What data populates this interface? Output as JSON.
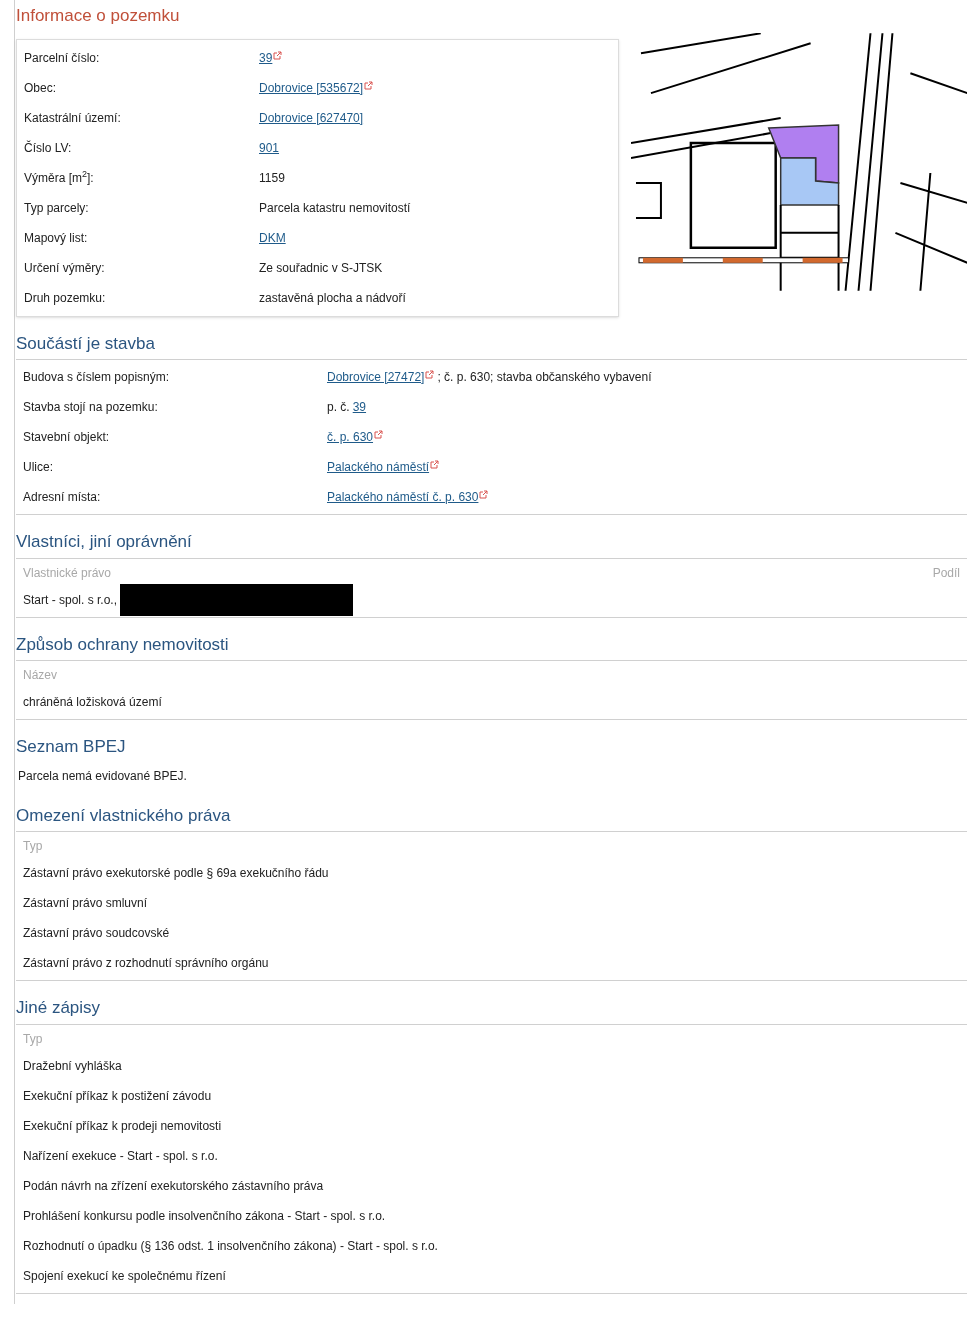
{
  "sections": [
    {
      "kind": "info",
      "title": "Informace o pozemku",
      "rows": [
        {
          "label": "Parcelní číslo:",
          "value": [
            {
              "kind": "link",
              "text": "39",
              "external": true
            }
          ]
        },
        {
          "label": "Obec:",
          "value": [
            {
              "kind": "link",
              "text": "Dobrovice [535672]",
              "external": true
            }
          ]
        },
        {
          "label": "Katastrální území:",
          "value": [
            {
              "kind": "link",
              "text": "Dobrovice [627470]",
              "external": false
            }
          ]
        },
        {
          "label": "Číslo LV:",
          "value": [
            {
              "kind": "link",
              "text": "901",
              "external": false
            }
          ]
        },
        {
          "label": "Výměra [m$^{2}$]:",
          "value": [
            {
              "kind": "text",
              "text": "1159"
            }
          ]
        },
        {
          "label": "Typ parcely:",
          "value": [
            {
              "kind": "text",
              "text": "Parcela katastru nemovitostí"
            }
          ]
        },
        {
          "label": "Mapový list:",
          "value": [
            {
              "kind": "link",
              "text": "DKM",
              "external": false
            }
          ]
        },
        {
          "label": "Určení výměry:",
          "value": [
            {
              "kind": "text",
              "text": "Ze souřadnic v S-JTSK"
            }
          ]
        },
        {
          "label": "Druh pozemku:",
          "value": [
            {
              "kind": "text",
              "text": "zastavěná plocha a nádvoří"
            }
          ]
        }
      ]
    },
    {
      "kind": "detail",
      "title": "Součástí je stavba",
      "rows": [
        {
          "label": "Budova s číslem popisným:",
          "value": [
            {
              "kind": "link",
              "text": "Dobrovice [27472]",
              "external": true
            },
            {
              "kind": "text",
              "text": "; č. p. 630; stavba občanského vybavení"
            }
          ]
        },
        {
          "label": "Stavba stojí na pozemku:",
          "value": [
            {
              "kind": "text",
              "text": "p. č."
            },
            {
              "kind": "link",
              "text": "39",
              "external": false
            }
          ]
        },
        {
          "label": "Stavební objekt:",
          "value": [
            {
              "kind": "link",
              "text": "č. p. 630",
              "external": true
            }
          ]
        },
        {
          "label": "Ulice:",
          "value": [
            {
              "kind": "link",
              "text": "Palackého náměstí",
              "external": true
            }
          ]
        },
        {
          "label": "Adresní místa:",
          "value": [
            {
              "kind": "link",
              "text": "Palackého náměstí č. p. 630",
              "external": true
            }
          ]
        }
      ]
    },
    {
      "kind": "table",
      "title": "Vlastníci, jiní oprávnění",
      "columns": [
        "Vlastnické právo",
        "Podíl"
      ],
      "rows": [
        {
          "text": "Start - spol. s r.o.,",
          "redacted": true
        }
      ]
    },
    {
      "kind": "table",
      "title": "Způsob ochrany nemovitosti",
      "columns": [
        "Název"
      ],
      "rows": [
        {
          "text": "chráněná ložisková území",
          "redacted": false
        }
      ]
    },
    {
      "kind": "note",
      "title": "Seznam BPEJ",
      "text": "Parcela nemá evidované BPEJ."
    },
    {
      "kind": "table",
      "title": "Omezení vlastnického práva",
      "columns": [
        "Typ"
      ],
      "rows": [
        {
          "text": "Zástavní právo exekutorské podle § 69a exekučního řádu",
          "redacted": false
        },
        {
          "text": "Zástavní právo smluvní",
          "redacted": false
        },
        {
          "text": "Zástavní právo soudcovské",
          "redacted": false
        },
        {
          "text": "Zástavní právo z rozhodnutí správního orgánu",
          "redacted": false
        }
      ]
    },
    {
      "kind": "table",
      "title": "Jiné zápisy",
      "columns": [
        "Typ"
      ],
      "rows": [
        {
          "text": "Dražební vyhláška",
          "redacted": false
        },
        {
          "text": "Exekuční příkaz k postižení závodu",
          "redacted": false
        },
        {
          "text": "Exekuční příkaz k prodeji nemovitosti",
          "redacted": false
        },
        {
          "text": "Nařízení exekuce - Start - spol. s r.o.",
          "redacted": false
        },
        {
          "text": "Podán návrh na zřízení exekutorského zástavního práva",
          "redacted": false
        },
        {
          "text": "Prohlášení konkursu podle insolvenčního zákona - Start - spol. s r.o.",
          "redacted": false
        },
        {
          "text": "Rozhodnutí o úpadku (§ 136 odst. 1 insolvenčního zákona) - Start - spol. s r.o.",
          "redacted": false
        },
        {
          "text": "Spojení exekucí ke společnému řízení",
          "redacted": false
        }
      ]
    }
  ]
}
